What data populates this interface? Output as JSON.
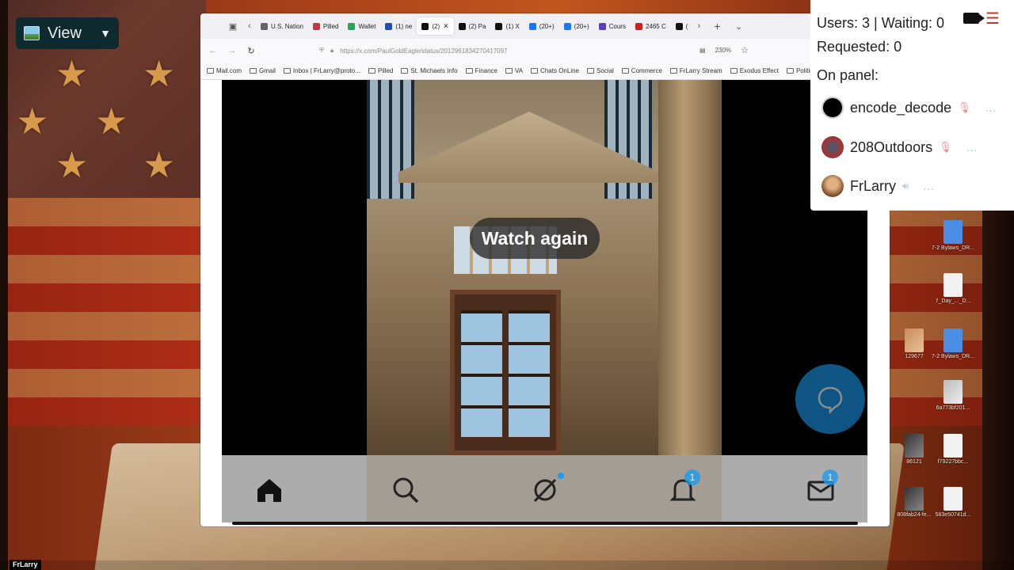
{
  "view_button": {
    "label": "View"
  },
  "browser": {
    "tabs": [
      {
        "label": "U.S. Nation",
        "fav": "#666666"
      },
      {
        "label": "Pilled",
        "fav": "#cc3344"
      },
      {
        "label": "Wallet",
        "fav": "#22aa55"
      },
      {
        "label": "(1) ne",
        "fav": "#1d4fb0"
      },
      {
        "label": "(2)",
        "fav": "#111111",
        "active": true
      },
      {
        "label": "(2) Pa",
        "fav": "#111111"
      },
      {
        "label": "(1) X",
        "fav": "#111111"
      },
      {
        "label": "(20+)",
        "fav": "#1877f2"
      },
      {
        "label": "(20+)",
        "fav": "#1877f2"
      },
      {
        "label": "Cours",
        "fav": "#5a3fc0"
      },
      {
        "label": "2465 C",
        "fav": "#cc2222"
      },
      {
        "label": "(",
        "fav": "#111111"
      }
    ],
    "url": "https://x.com/PaulGoldEagle/status/2012961834270417097",
    "zoom": "230%",
    "bookmarks": [
      "Mail.com",
      "Gmail",
      "Inbox | FrLarry@proto...",
      "Pilled",
      "St. Michaels Info",
      "Finance",
      "VA",
      "Chats OnLine",
      "Social",
      "Commerce",
      "FrLarry Stream",
      "Exodus Effect",
      "Political"
    ]
  },
  "video": {
    "overlay_label": "Watch again",
    "nav": {
      "home": "home-icon",
      "search": "search-icon",
      "grok": "grok-icon",
      "notifications_badge": "1",
      "messages_badge": "1"
    }
  },
  "desktop_icons": [
    {
      "label": "7-2 Bylaws_DR...",
      "kind": "doc"
    },
    {
      "label": "7_Day_..._D...",
      "kind": "white"
    },
    {
      "label": "129677",
      "kind": "pic"
    },
    {
      "label": "7-2 Bylaws_DR...",
      "kind": "doc"
    },
    {
      "label": "6a773bf201...",
      "kind": "grey"
    },
    {
      "label": "86121",
      "kind": "dark"
    },
    {
      "label": "f79227bbc...",
      "kind": "white"
    },
    {
      "label": "808fab24-fe...",
      "kind": "dark"
    },
    {
      "label": "583e50741d...",
      "kind": "white"
    }
  ],
  "panel": {
    "stats_line1": "Users: 3 | Waiting: 0",
    "stats_line2": "Requested: 0",
    "on_panel_label": "On panel:",
    "users": [
      {
        "name": "encode_decode",
        "muted": true
      },
      {
        "name": "208Outdoors",
        "muted": true
      },
      {
        "name": "FrLarry",
        "muted": false
      }
    ]
  },
  "host_label": "FrLarry"
}
